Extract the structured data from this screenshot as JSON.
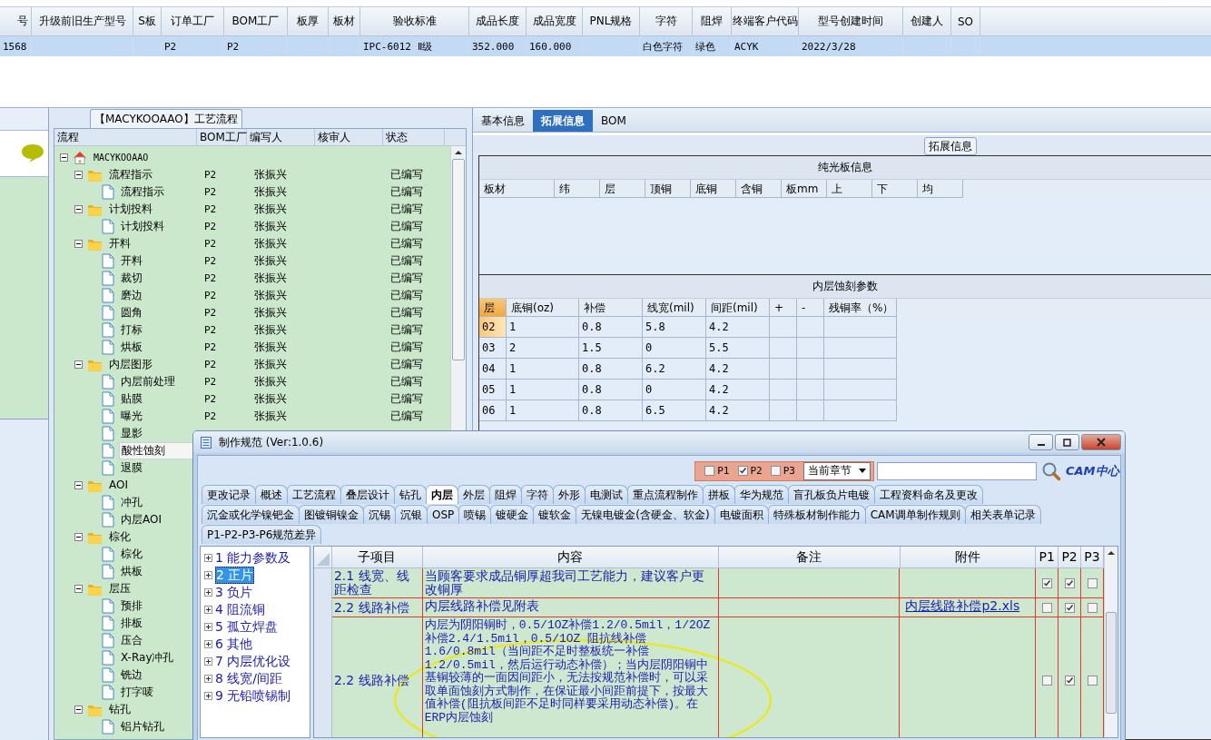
{
  "main_grid": {
    "columns": [
      "号",
      "升级前旧生产型号",
      "S板",
      "订单工厂",
      "BOM工厂",
      "板厚",
      "板材",
      "验收标准",
      "成品长度",
      "成品宽度",
      "PNL规格",
      "字符",
      "阻焊",
      "终端客户代码",
      "型号创建时间",
      "创建人",
      "SO"
    ],
    "rows": [
      {
        "selected": true,
        "cells": [
          "1568",
          null,
          null,
          "P2",
          "P2",
          null,
          null,
          "IPC-6012 Ⅱ级",
          "352.000",
          "160.000",
          null,
          "白色字符",
          "绿色",
          "ACYK",
          "2022/3/28",
          null,
          null
        ]
      }
    ]
  },
  "process_panel": {
    "title": "【MACYKOOAAO】工艺流程",
    "columns": [
      "流程",
      "BOM工厂",
      "编写人",
      "核审人",
      "状态"
    ],
    "tree": [
      {
        "label": "MACYKOOAAO",
        "kind": "root",
        "expanded": true,
        "selected": false,
        "children": [
          {
            "label": "流程指示",
            "kind": "folder",
            "bom_factory": "P2",
            "writer": "张振兴",
            "status": "已编写",
            "expanded": true,
            "selected": false,
            "children": [
              {
                "label": "流程指示",
                "kind": "step",
                "bom_factory": "P2",
                "writer": "张振兴",
                "status": "已编写",
                "selected": false
              }
            ]
          },
          {
            "label": "计划投料",
            "kind": "folder",
            "bom_factory": "P2",
            "writer": "张振兴",
            "status": "已编写",
            "expanded": true,
            "selected": false,
            "children": [
              {
                "label": "计划投料",
                "kind": "step",
                "bom_factory": "P2",
                "writer": "张振兴",
                "status": "已编写",
                "selected": false
              }
            ]
          },
          {
            "label": "开料",
            "kind": "folder",
            "bom_factory": "P2",
            "writer": "张振兴",
            "status": "已编写",
            "expanded": true,
            "selected": false,
            "children": [
              {
                "label": "开料",
                "kind": "step",
                "bom_factory": "P2",
                "writer": "张振兴",
                "status": "已编写",
                "selected": false
              },
              {
                "label": "裁切",
                "kind": "step",
                "bom_factory": "P2",
                "writer": "张振兴",
                "status": "已编写",
                "selected": false
              },
              {
                "label": "磨边",
                "kind": "step",
                "bom_factory": "P2",
                "writer": "张振兴",
                "status": "已编写",
                "selected": false
              },
              {
                "label": "圆角",
                "kind": "step",
                "bom_factory": "P2",
                "writer": "张振兴",
                "status": "已编写",
                "selected": false
              },
              {
                "label": "打标",
                "kind": "step",
                "bom_factory": "P2",
                "writer": "张振兴",
                "status": "已编写",
                "selected": false
              },
              {
                "label": "烘板",
                "kind": "step",
                "bom_factory": "P2",
                "writer": "张振兴",
                "status": "已编写",
                "selected": false
              }
            ]
          },
          {
            "label": "内层图形",
            "kind": "folder",
            "bom_factory": "P2",
            "writer": "张振兴",
            "status": "已编写",
            "expanded": true,
            "selected": false,
            "children": [
              {
                "label": "内层前处理",
                "kind": "step",
                "bom_factory": "P2",
                "writer": "张振兴",
                "status": "已编写",
                "selected": false
              },
              {
                "label": "贴膜",
                "kind": "step",
                "bom_factory": "P2",
                "writer": "张振兴",
                "status": "已编写",
                "selected": false
              },
              {
                "label": "曝光",
                "kind": "step",
                "bom_factory": "P2",
                "writer": "张振兴",
                "status": "已编写",
                "selected": false
              },
              {
                "label": "显影",
                "kind": "step",
                "selected": false
              },
              {
                "label": "酸性蚀刻",
                "kind": "step",
                "selected": true
              },
              {
                "label": "退膜",
                "kind": "step",
                "selected": false
              }
            ]
          },
          {
            "label": "AOI",
            "kind": "folder",
            "expanded": true,
            "selected": false,
            "children": [
              {
                "label": "冲孔",
                "kind": "step",
                "selected": false
              },
              {
                "label": "内层AOI",
                "kind": "step",
                "selected": false
              }
            ]
          },
          {
            "label": "棕化",
            "kind": "folder",
            "expanded": true,
            "selected": false,
            "children": [
              {
                "label": "棕化",
                "kind": "step",
                "selected": false
              },
              {
                "label": "烘板",
                "kind": "step",
                "selected": false
              }
            ]
          },
          {
            "label": "层压",
            "kind": "folder",
            "expanded": true,
            "selected": false,
            "children": [
              {
                "label": "预排",
                "kind": "step",
                "selected": false
              },
              {
                "label": "排板",
                "kind": "step",
                "selected": false
              },
              {
                "label": "压合",
                "kind": "step",
                "selected": false
              },
              {
                "label": "X-Ray冲孔",
                "kind": "step",
                "selected": false
              },
              {
                "label": "铣边",
                "kind": "step",
                "selected": false
              },
              {
                "label": "打字唛",
                "kind": "step",
                "selected": false
              }
            ]
          },
          {
            "label": "钻孔",
            "kind": "folder",
            "expanded": true,
            "selected": false,
            "children": [
              {
                "label": "铝片钻孔",
                "kind": "step",
                "selected": false
              }
            ]
          }
        ]
      }
    ]
  },
  "detail_panel": {
    "tabs": [
      {
        "label": "基本信息",
        "selected": false
      },
      {
        "label": "拓展信息",
        "selected": true
      },
      {
        "label": "BOM",
        "selected": false
      }
    ],
    "group_title": "拓展信息",
    "plain_board": {
      "title": "纯光板信息",
      "columns": [
        "板材",
        "纬",
        "层",
        "顶铜",
        "底铜",
        "含铜",
        "板mm",
        "上",
        "下",
        "均"
      ]
    },
    "inner_etch": {
      "title": "内层蚀刻参数",
      "columns": [
        "层",
        "底铜(oz)",
        "补偿",
        "线宽(mil)",
        "间距(mil)",
        "+",
        "-",
        "残铜率（%）"
      ],
      "rows": [
        {
          "selected": true,
          "cells": [
            "02",
            "1",
            "0.8",
            "5.8",
            "4.2"
          ]
        },
        {
          "selected": false,
          "cells": [
            "03",
            "2",
            "1.5",
            "0",
            "5.5"
          ]
        },
        {
          "selected": false,
          "cells": [
            "04",
            "1",
            "0.8",
            "6.2",
            "4.2"
          ]
        },
        {
          "selected": false,
          "cells": [
            "05",
            "1",
            "0.8",
            "0",
            "4.2"
          ]
        },
        {
          "selected": false,
          "cells": [
            "06",
            "1",
            "0.8",
            "6.5",
            "4.2"
          ]
        }
      ]
    }
  },
  "dialog": {
    "title": "制作规范 (Ver:1.0.6)",
    "filters": [
      {
        "label": "P1",
        "checked": false
      },
      {
        "label": "P2",
        "checked": true
      },
      {
        "label": "P3",
        "checked": false
      }
    ],
    "chapter": "当前章节",
    "logo": "CAM中心",
    "tab_rows": [
      [
        {
          "label": "更改记录",
          "selected": false
        },
        {
          "label": "概述",
          "selected": false
        },
        {
          "label": "工艺流程",
          "selected": false
        },
        {
          "label": "叠层设计",
          "selected": false
        },
        {
          "label": "钻孔",
          "selected": false
        },
        {
          "label": "内层",
          "selected": true
        },
        {
          "label": "外层",
          "selected": false
        },
        {
          "label": "阻焊",
          "selected": false
        },
        {
          "label": "字符",
          "selected": false
        },
        {
          "label": "外形",
          "selected": false
        },
        {
          "label": "电测试",
          "selected": false
        },
        {
          "label": "重点流程制作",
          "selected": false
        },
        {
          "label": "拼板",
          "selected": false
        },
        {
          "label": "华为规范",
          "selected": false
        },
        {
          "label": "盲孔板负片电镀",
          "selected": false
        },
        {
          "label": "工程资料命名及更改",
          "selected": false
        }
      ],
      [
        {
          "label": "沉金或化学镍钯金",
          "selected": false
        },
        {
          "label": "图镀铜镍金",
          "selected": false
        },
        {
          "label": "沉锡",
          "selected": false
        },
        {
          "label": "沉银",
          "selected": false
        },
        {
          "label": "OSP",
          "selected": false
        },
        {
          "label": "喷锡",
          "selected": false
        },
        {
          "label": "镀硬金",
          "selected": false
        },
        {
          "label": "镀软金",
          "selected": false
        },
        {
          "label": "无镍电镀金(含硬金、软金)",
          "selected": false
        },
        {
          "label": "电镀面积",
          "selected": false
        },
        {
          "label": "特殊板材制作能力",
          "selected": false
        },
        {
          "label": "CAM调单制作规则",
          "selected": false
        },
        {
          "label": "相关表单记录",
          "selected": false
        }
      ],
      [
        {
          "label": "P1-P2-P3-P6规范差异",
          "selected": false
        }
      ]
    ],
    "outline": [
      {
        "label": "1 能力参数及",
        "selected": false
      },
      {
        "label": "2 正片",
        "selected": true
      },
      {
        "label": "3 负片",
        "selected": false
      },
      {
        "label": "4 阻流铜",
        "selected": false
      },
      {
        "label": "5 孤立焊盘",
        "selected": false
      },
      {
        "label": "6 其他",
        "selected": false
      },
      {
        "label": "7 内层优化设",
        "selected": false
      },
      {
        "label": "8 线宽/间距",
        "selected": false
      },
      {
        "label": "9 无铅喷锡制",
        "selected": false
      }
    ],
    "columns": [
      "子项目",
      "内容",
      "备注",
      "附件",
      "P1",
      "P2",
      "P3"
    ],
    "rows": [
      {
        "item": "2.1 线宽、线距检查",
        "content": "当顾客要求成品铜厚超我司工艺能力，建议客户更改铜厚",
        "p1": true,
        "p2": true,
        "p3": false
      },
      {
        "item": "2.2 线路补偿",
        "content": "内层线路补偿见附表",
        "attachment": "内层线路补偿p2.xls",
        "p1": false,
        "p2": true,
        "p3": false
      },
      {
        "item": "2.2 线路补偿",
        "content": "内层为阴阳铜时，0.5/1OZ补偿1.2/0.5mil，1/2OZ补偿2.4/1.5mil，0.5/1OZ 阻抗线补偿1.6/0.8mil（当间距不足时整板统一补偿1.2/0.5mil，然后运行动态补偿）；当内层阴阳铜中基铜较薄的一面因间距小，无法按规范补偿时，可以采取单面蚀刻方式制作，在保证最小间距前提下，按最大值补偿(阻抗板间距不足时同样要采用动态补偿)。在ERP内层蚀刻",
        "p1": false,
        "p2": true,
        "p3": false
      }
    ]
  }
}
